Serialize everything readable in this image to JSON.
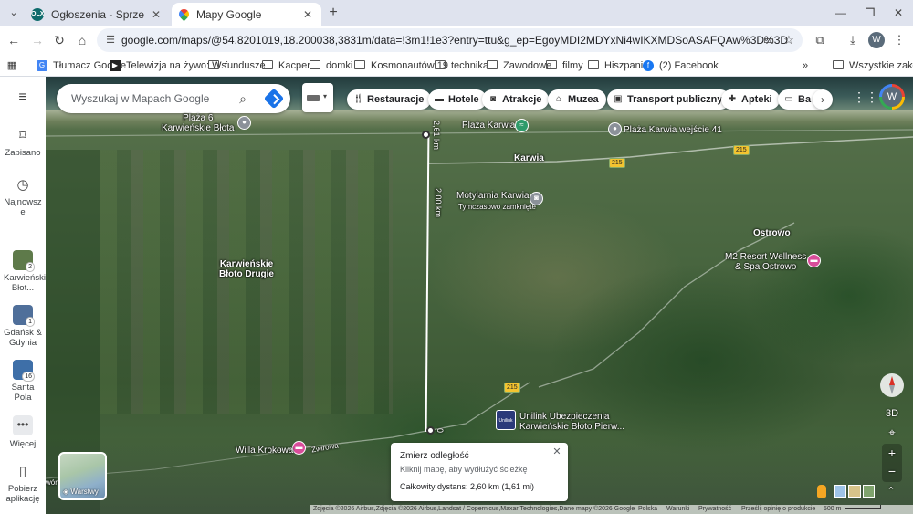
{
  "browser": {
    "tabs": [
      {
        "title": "Ogłoszenia - Sprzedam, kupię na",
        "favicon_text": "OLX",
        "active": false
      },
      {
        "title": "Mapy Google",
        "active": true
      }
    ],
    "url": "google.com/maps/@54.8201019,18.200038,3831m/data=!3m1!1e3?entry=ttu&g_ep=EgoyMDI2MDYxNi4wIKXMDSoASAFQAw%3D%3D",
    "profile_initial": "W",
    "bookmarks": [
      {
        "label": "Tłumacz Google",
        "icon": "google-translate-icon"
      },
      {
        "label": "Telewizja na żywo: Ws...",
        "icon": "tv-icon"
      },
      {
        "label": "fundusze",
        "icon": "folder-icon"
      },
      {
        "label": "Kacper",
        "icon": "folder-icon"
      },
      {
        "label": "domki",
        "icon": "folder-icon"
      },
      {
        "label": "Kosmonautów 19",
        "icon": "folder-icon"
      },
      {
        "label": "technika",
        "icon": "folder-icon"
      },
      {
        "label": "Zawodowe",
        "icon": "folder-icon"
      },
      {
        "label": "filmy",
        "icon": "folder-icon"
      },
      {
        "label": "Hiszpania",
        "icon": "folder-icon"
      },
      {
        "label": "(2) Facebook",
        "icon": "facebook-icon"
      }
    ],
    "all_bookmarks": "Wszystkie zakładki"
  },
  "rail": {
    "saved": "Zapisano",
    "recent": "Najnowsze",
    "recent_items": [
      {
        "label": "Karwieńskie Błot...",
        "badge": "2"
      },
      {
        "label": "Gdańsk & Gdynia",
        "badge": "1"
      },
      {
        "label": "Santa Pola",
        "badge": "16"
      }
    ],
    "more": "Więcej",
    "get_app": "Pobierz aplikację"
  },
  "search": {
    "placeholder": "Wyszukaj w Mapach Google"
  },
  "categories": [
    {
      "label": "Restauracje",
      "icon": "restaurant-icon"
    },
    {
      "label": "Hotele",
      "icon": "hotel-icon"
    },
    {
      "label": "Atrakcje",
      "icon": "camera-icon"
    },
    {
      "label": "Muzea",
      "icon": "museum-icon"
    },
    {
      "label": "Transport publiczny",
      "icon": "transit-icon"
    },
    {
      "label": "Apteki",
      "icon": "pharmacy-icon"
    },
    {
      "label": "Ba",
      "icon": "atm-icon"
    }
  ],
  "account_initial": "W",
  "map": {
    "labels": {
      "plaza6": "Plaża 6\nKarwieńskie Błota",
      "plaza_karwia": "Plaża Karwia",
      "plaza_karwia41": "Plaża Karwia wejście 41",
      "karwia": "Karwia",
      "motylarnia": "Motylarnia Karwia",
      "motylarnia_status": "Tymczasowo zamknięte",
      "ostrowo": "Ostrowo",
      "m2": "M2 Resort Wellness\n& Spa Ostrowo",
      "karwienskie_bloto": "Karwieńskie\nBłoto Drugie",
      "unilink": "Unilink Ubezpieczenia\nKarwieńskie Błoto Pierw...",
      "willa": "Willa Krokowa",
      "zwirowa": "Żwirowa",
      "road_215": "215",
      "measure_2_61": "2,61 km",
      "measure_2_00": "2,00 km",
      "measure_0": "0",
      "layers_edge": "wór"
    },
    "layers_label": "Warstwy",
    "three_d": "3D"
  },
  "measure_popup": {
    "title": "Zmierz odległość",
    "hint": "Kliknij mapę, aby wydłużyć ścieżkę",
    "total": "Całkowity dystans: 2,60 km (1,61 mi)"
  },
  "attribution": {
    "imagery": "Zdjęcia ©2026 Airbus,Zdjęcia ©2026 Airbus,Landsat / Copernicus,Maxar Technologies,Dane mapy ©2026 Google",
    "country": "Polska",
    "terms": "Warunki",
    "privacy": "Prywatność",
    "feedback": "Prześlij opinię o produkcie",
    "scale": "500 m"
  }
}
